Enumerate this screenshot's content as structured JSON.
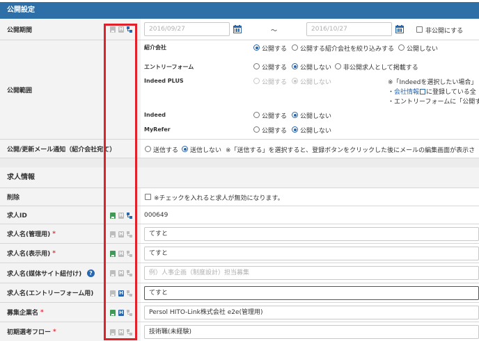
{
  "publish": {
    "header": "公開設定",
    "period": {
      "label": "公開期間",
      "start_placeholder": "2016/09/27",
      "tilde": "〜",
      "end_placeholder": "2016/10/27",
      "private_label": "非公開にする"
    },
    "scope": {
      "label": "公開範囲",
      "agency": {
        "label": "紹介会社",
        "options": [
          "公開する",
          "公開する紹介会社を絞り込みする",
          "公開しない"
        ]
      },
      "entry_form": {
        "label": "エントリーフォーム",
        "options": [
          "公開する",
          "公開しない",
          "非公開求人として掲載する"
        ]
      },
      "indeed_plus": {
        "label": "Indeed PLUS",
        "options": [
          "公開する",
          "公開しない"
        ],
        "note1": "※「Indeedを選択したい場合」",
        "note2_prefix": "・",
        "note2_link": "会社情報",
        "note2_suffix": "に登録している全",
        "note3": "・エントリーフォームに「公開す"
      },
      "indeed": {
        "label": "Indeed",
        "options": [
          "公開する",
          "公開しない"
        ]
      },
      "myrefer": {
        "label": "MyRefer",
        "options": [
          "公開する",
          "公開しない"
        ]
      }
    },
    "mail": {
      "label": "公開/更新メール通知（紹介会社宛て）",
      "options": [
        "送信する",
        "送信しない"
      ],
      "note": "※「送信する」を選択すると、登録ボタンをクリックした後にメールの編集画面が表示さ"
    }
  },
  "job": {
    "header": "求人情報",
    "rows": [
      {
        "label": "削除",
        "required": "",
        "check_text": "※チェックを入れると求人が無効になります。"
      },
      {
        "label": "求人ID",
        "required": "",
        "value": "000649"
      },
      {
        "label": "求人名(管理用)",
        "required": "*",
        "value": "てすと"
      },
      {
        "label": "求人名(表示用)",
        "required": "*",
        "value": "てすと"
      },
      {
        "label": "求人名(媒体サイト紐付け)",
        "required": "",
        "help": "?",
        "placeholder": "例）人事企画（制度設計）担当募集"
      },
      {
        "label": "求人名(エントリーフォーム用)",
        "required": "",
        "value": "てすと"
      },
      {
        "label": "募集企業名",
        "required": "*",
        "value": "Persol HITO-Link株式会社 e2e(管理用)"
      },
      {
        "label": "初期選考フロー",
        "required": "*",
        "value": "技術職(未経験)"
      }
    ]
  },
  "colors": {
    "header_blue": "#2f6fa8",
    "accent_blue": "#2a66ad",
    "highlight_red": "#e2202b",
    "green_icon": "#3f9a55"
  }
}
